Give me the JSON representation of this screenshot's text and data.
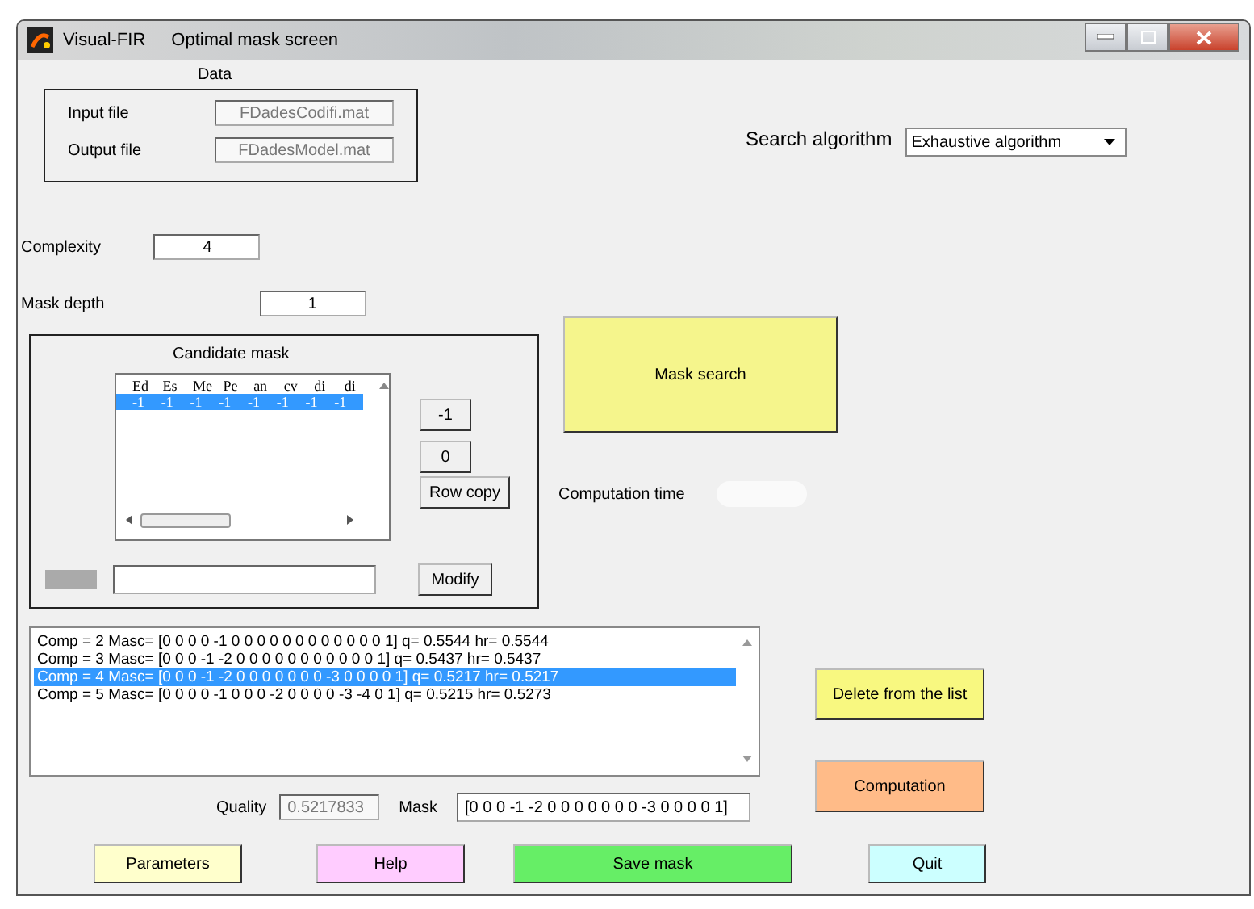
{
  "window": {
    "app": "Visual-FIR",
    "title": "Optimal mask screen"
  },
  "data": {
    "label": "Data",
    "fields": [
      {
        "label": "Input file",
        "value": "FDadesCodifi.mat"
      },
      {
        "label": "Output file",
        "value": "FDadesModel.mat"
      }
    ]
  },
  "search_algorithm": {
    "label": "Search algorithm",
    "value": "Exhaustive algorithm"
  },
  "complexity": {
    "label": "Complexity",
    "value": "4"
  },
  "mask_depth": {
    "label": "Mask depth",
    "value": "1"
  },
  "candidate_mask": {
    "label": "Candidate mask",
    "columns": [
      "Ed",
      "Es",
      "Me",
      "Pe",
      "an",
      "cv",
      "di",
      "di"
    ],
    "rows": [
      {
        "cells": [
          "-1",
          "-1",
          "-1",
          "-1",
          "-1",
          "-1",
          "-1",
          "-1"
        ],
        "selected": true
      }
    ],
    "buttons": [
      "-1",
      "0",
      "Row copy"
    ],
    "modify_button": "Modify"
  },
  "mask_search_button": "Mask search",
  "computation_time": {
    "label": "Computation time"
  },
  "results": [
    {
      "text": "Comp = 2  Masc= [0 0 0 0 -1 0 0 0 0 0 0 0 0 0 0 0 0 1]   q= 0.5544  hr= 0.5544",
      "selected": false
    },
    {
      "text": "Comp = 3  Masc= [0 0 0 -1 -2 0 0 0 0 0 0 0 0 0 0 0 1]   q= 0.5437  hr= 0.5437",
      "selected": false
    },
    {
      "text": "Comp = 4  Masc= [0 0 0 -1 -2 0 0 0 0 0 0 0 -3 0 0 0 0 1]   q= 0.5217  hr= 0.5217",
      "selected": true
    },
    {
      "text": "Comp = 5  Masc= [0 0 0 0 -1 0 0 0 -2 0 0 0 0 -3 -4 0 1]   q= 0.5215  hr= 0.5273",
      "selected": false
    }
  ],
  "delete_button": "Delete from the list",
  "computation_button": "Computation",
  "quality": {
    "label": "Quality",
    "value": "0.5217833"
  },
  "mask": {
    "label": "Mask",
    "value": "[0 0 0 -1 -2 0 0 0 0 0 0 0 -3 0 0 0 0 1]"
  },
  "bottom_buttons": [
    {
      "label": "Parameters",
      "color": "#ffffcc"
    },
    {
      "label": "Help",
      "color": "#ffccff"
    },
    {
      "label": "Save mask",
      "color": "#66ee66"
    },
    {
      "label": "Quit",
      "color": "#ccffff"
    }
  ]
}
